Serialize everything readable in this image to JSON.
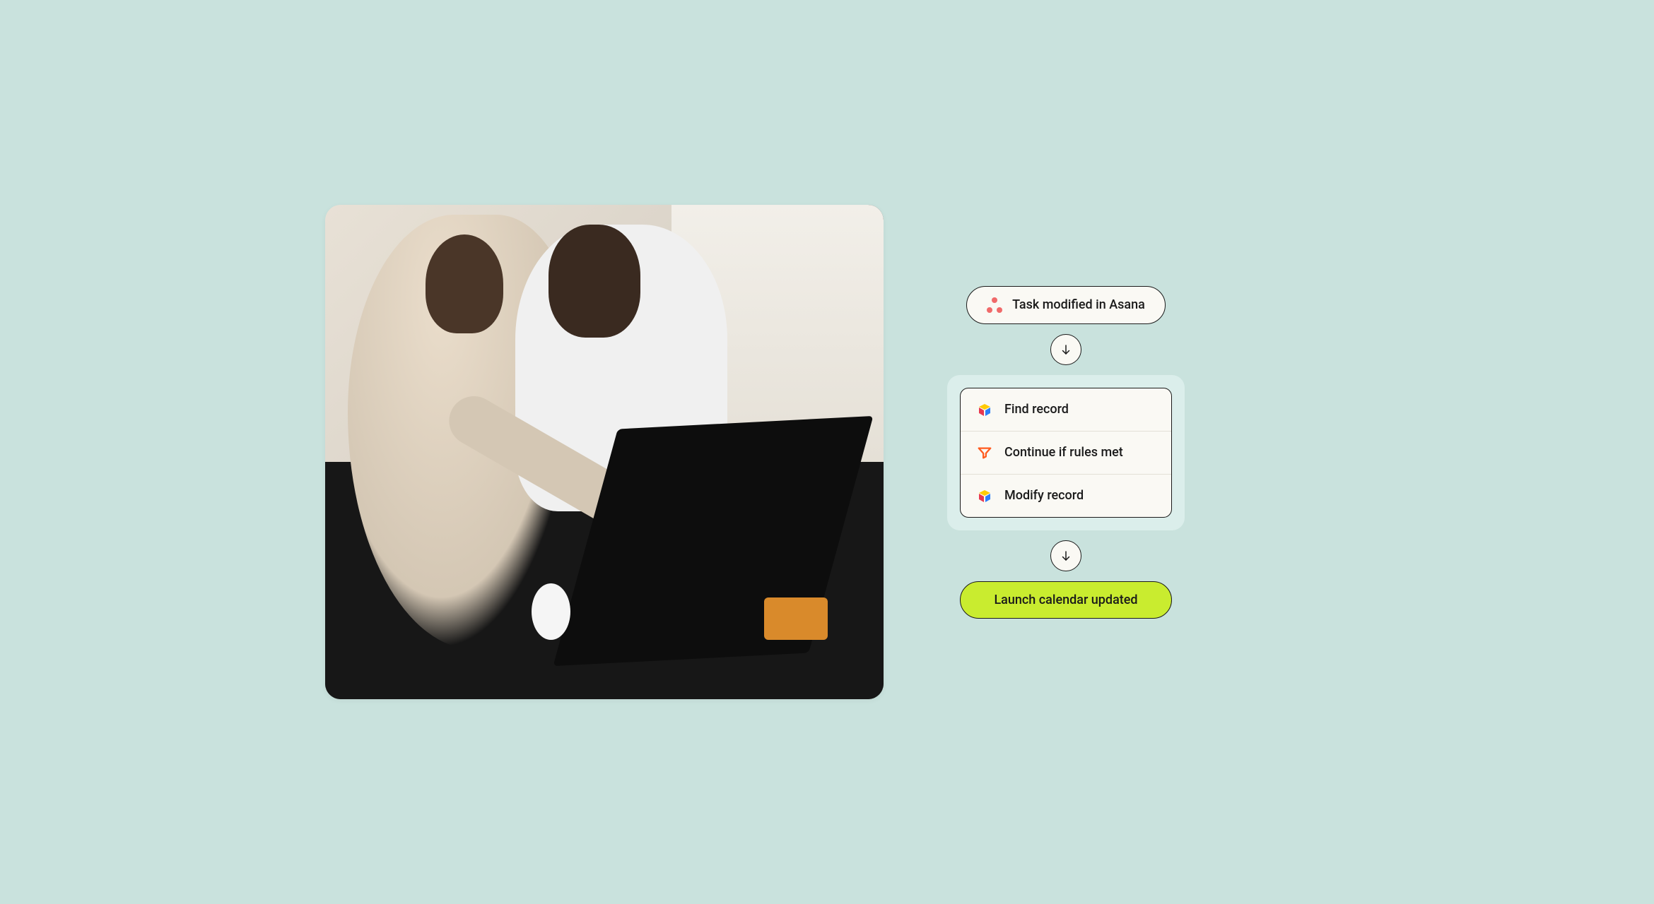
{
  "trigger": {
    "icon": "asana-icon",
    "label": "Task modified in Asana"
  },
  "steps": [
    {
      "icon": "airtable-icon",
      "label": "Find record"
    },
    {
      "icon": "filter-icon",
      "label": "Continue if rules met"
    },
    {
      "icon": "airtable-icon",
      "label": "Modify record"
    }
  ],
  "result": {
    "label": "Launch calendar updated"
  },
  "colors": {
    "background": "#c9e2dd",
    "card": "#faf9f4",
    "stepsWrap": "#dbeeeb",
    "accent": "#c9ec2f",
    "asana": "#f06a6a",
    "filter": "#ff5b1f"
  },
  "photo": {
    "description": "Two people collaborating while pointing at a laptop screen on a dark desk, with a white mouse and orange tablet nearby; bright window in background."
  }
}
